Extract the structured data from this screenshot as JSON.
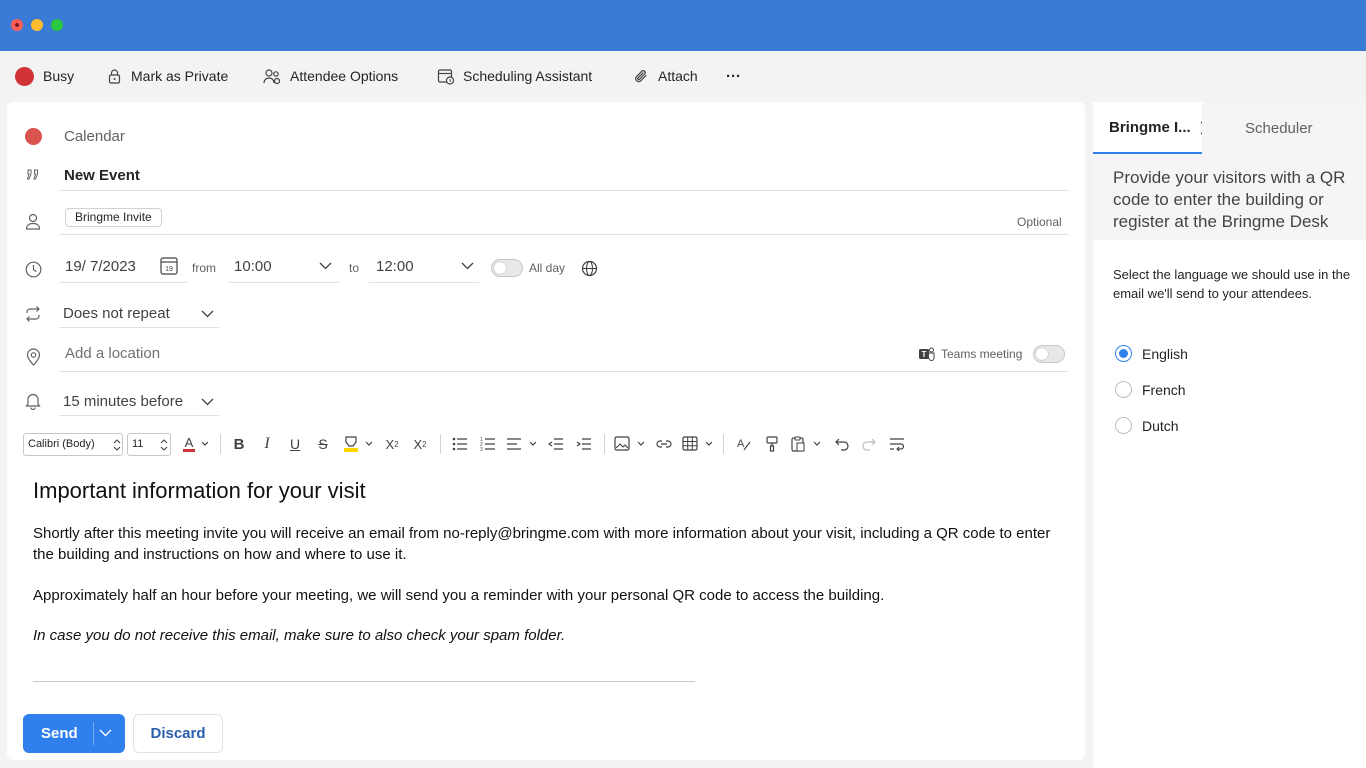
{
  "toolbar": {
    "busy": "Busy",
    "private": "Mark as Private",
    "attendee": "Attendee Options",
    "scheduling": "Scheduling Assistant",
    "attach": "Attach",
    "more": "···"
  },
  "form": {
    "calendar": "Calendar",
    "title": "New Event",
    "attendee_chip": "Bringme Invite",
    "optional": "Optional",
    "date": "19/ 7/2023",
    "from_label": "from",
    "start_time": "10:00",
    "to_label": "to",
    "end_time": "12:00",
    "all_day": "All day",
    "repeat": "Does not repeat",
    "location_placeholder": "Add a location",
    "teams": "Teams meeting",
    "reminder": "15 minutes before"
  },
  "format": {
    "font": "Calibri (Body)",
    "size": "11",
    "calendar_day": "19"
  },
  "body": {
    "heading": "Important information for your visit",
    "p1": "Shortly after this meeting invite you will receive an email from no-reply@bringme.com with more information about your visit, including a QR code to enter the building and instructions on how and where to use it.",
    "p2": "Approximately half an hour before your meeting, we will send you a reminder with your personal QR code to access the building.",
    "p3": "In case you do not receive this email, make sure to also check your spam folder."
  },
  "actions": {
    "send": "Send",
    "discard": "Discard"
  },
  "panel": {
    "tab_active": "Bringme I...",
    "tab_inactive": "Scheduler",
    "intro": "Provide your visitors with a QR code to enter the building or register at the Bringme Desk",
    "description": "Select the language we should use in the email we'll send to your attendees.",
    "languages": [
      "English",
      "French",
      "Dutch"
    ],
    "selected_language": "English"
  },
  "colors": {
    "titlebar": "#3a7bd5",
    "accent": "#2f80ed",
    "busy": "#d13438"
  }
}
